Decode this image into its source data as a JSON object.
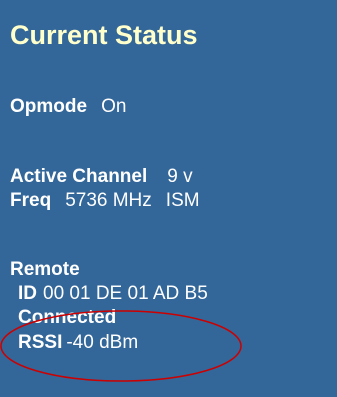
{
  "status": {
    "title": "Current Status",
    "opmode_label": "Opmode",
    "opmode_value": "On",
    "active_channel_label": "Active Channel",
    "active_channel_value": "9 v",
    "freq_label": "Freq",
    "freq_value": "5736 MHz",
    "freq_band": "ISM",
    "remote_label": "Remote",
    "id_label": "ID",
    "id_value": "00 01 DE 01 AD B5",
    "connected_label": "Connected",
    "rssi_label": "RSSI",
    "rssi_value": "-40 dBm"
  },
  "colors": {
    "panel_bg": "#336699",
    "title_text": "#ffffcc",
    "body_text": "#ffffff",
    "annotation_ellipse": "#cc0000"
  }
}
